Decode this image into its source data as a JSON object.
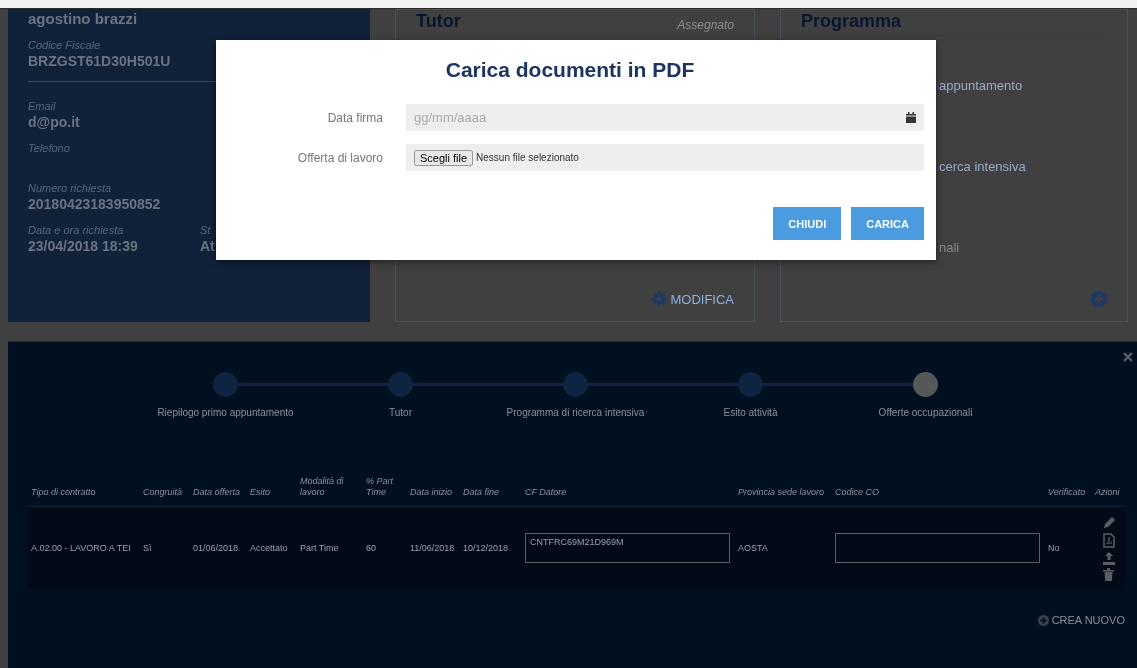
{
  "person_card": {
    "name": "agostino brazzi",
    "top_fields": [
      {
        "label": "Codice Fiscale",
        "value": "BRZGST61D30H501U"
      }
    ],
    "fields": [
      {
        "label": "Email",
        "value": "d@po.it"
      },
      {
        "label": "Telefono"
      },
      {
        "label": "Numero richiesta",
        "value": "20180423183950852"
      }
    ],
    "last_row": [
      {
        "label": "Data e ora richiesta",
        "value": "23/04/2018 18:39"
      },
      {
        "label": "St",
        "value": "At"
      }
    ]
  },
  "tutor_card": {
    "title": "Tutor",
    "status": "Assegnato",
    "action": "MODIFICA"
  },
  "program_card": {
    "title": "Programma",
    "items": [
      "appuntamento",
      "cerca intensiva",
      "nali"
    ]
  },
  "modal": {
    "title": "Carica documenti in PDF",
    "date_label": "Data firma",
    "date_placeholder": "gg/mm/aaaa",
    "file_label": "Offerta di lavoro",
    "file_button": "Scegli file",
    "file_status": "Nessun file selezionato",
    "buttons": [
      "CHIUDI",
      "CARICA"
    ]
  },
  "stepper": [
    {
      "label": "Riepilogo primo appuntamento",
      "selected": false
    },
    {
      "label": "Tutor",
      "selected": false
    },
    {
      "label": "Programma di ricerca intensiva",
      "selected": false
    },
    {
      "label": "Esito attività",
      "selected": false
    },
    {
      "label": "Offerte occupazionali",
      "selected": true
    }
  ],
  "table": {
    "columns": [
      "Tipo di contratto",
      "Congruità",
      "Data offerta",
      "Esito",
      "Modalità di lavoro",
      "% Part Time",
      "Data inizio",
      "Data fine",
      "CF Datore",
      "Provincia sede lavoro",
      "Codice CO",
      "Verificato",
      "Azioni"
    ],
    "rows": [
      {
        "cells": [
          {
            "kind": "text",
            "text": "A.02.00 - LAVORO A TEI"
          },
          {
            "kind": "text",
            "text": "Sì"
          },
          {
            "kind": "text",
            "text": "01/06/2018"
          },
          {
            "kind": "text",
            "text": "Accettato"
          },
          {
            "kind": "text",
            "text": "Part Time"
          },
          {
            "kind": "text",
            "text": "60"
          },
          {
            "kind": "text",
            "text": "11/06/2018"
          },
          {
            "kind": "text",
            "text": "10/12/2018"
          },
          {
            "kind": "field",
            "text": "CNTFRC69M21D969M"
          },
          {
            "kind": "text",
            "text": "AOSTA"
          },
          {
            "kind": "field"
          },
          {
            "kind": "text",
            "text": "No"
          },
          {
            "kind": "actions"
          }
        ]
      }
    ]
  },
  "create_button": "CREA NUOVO"
}
